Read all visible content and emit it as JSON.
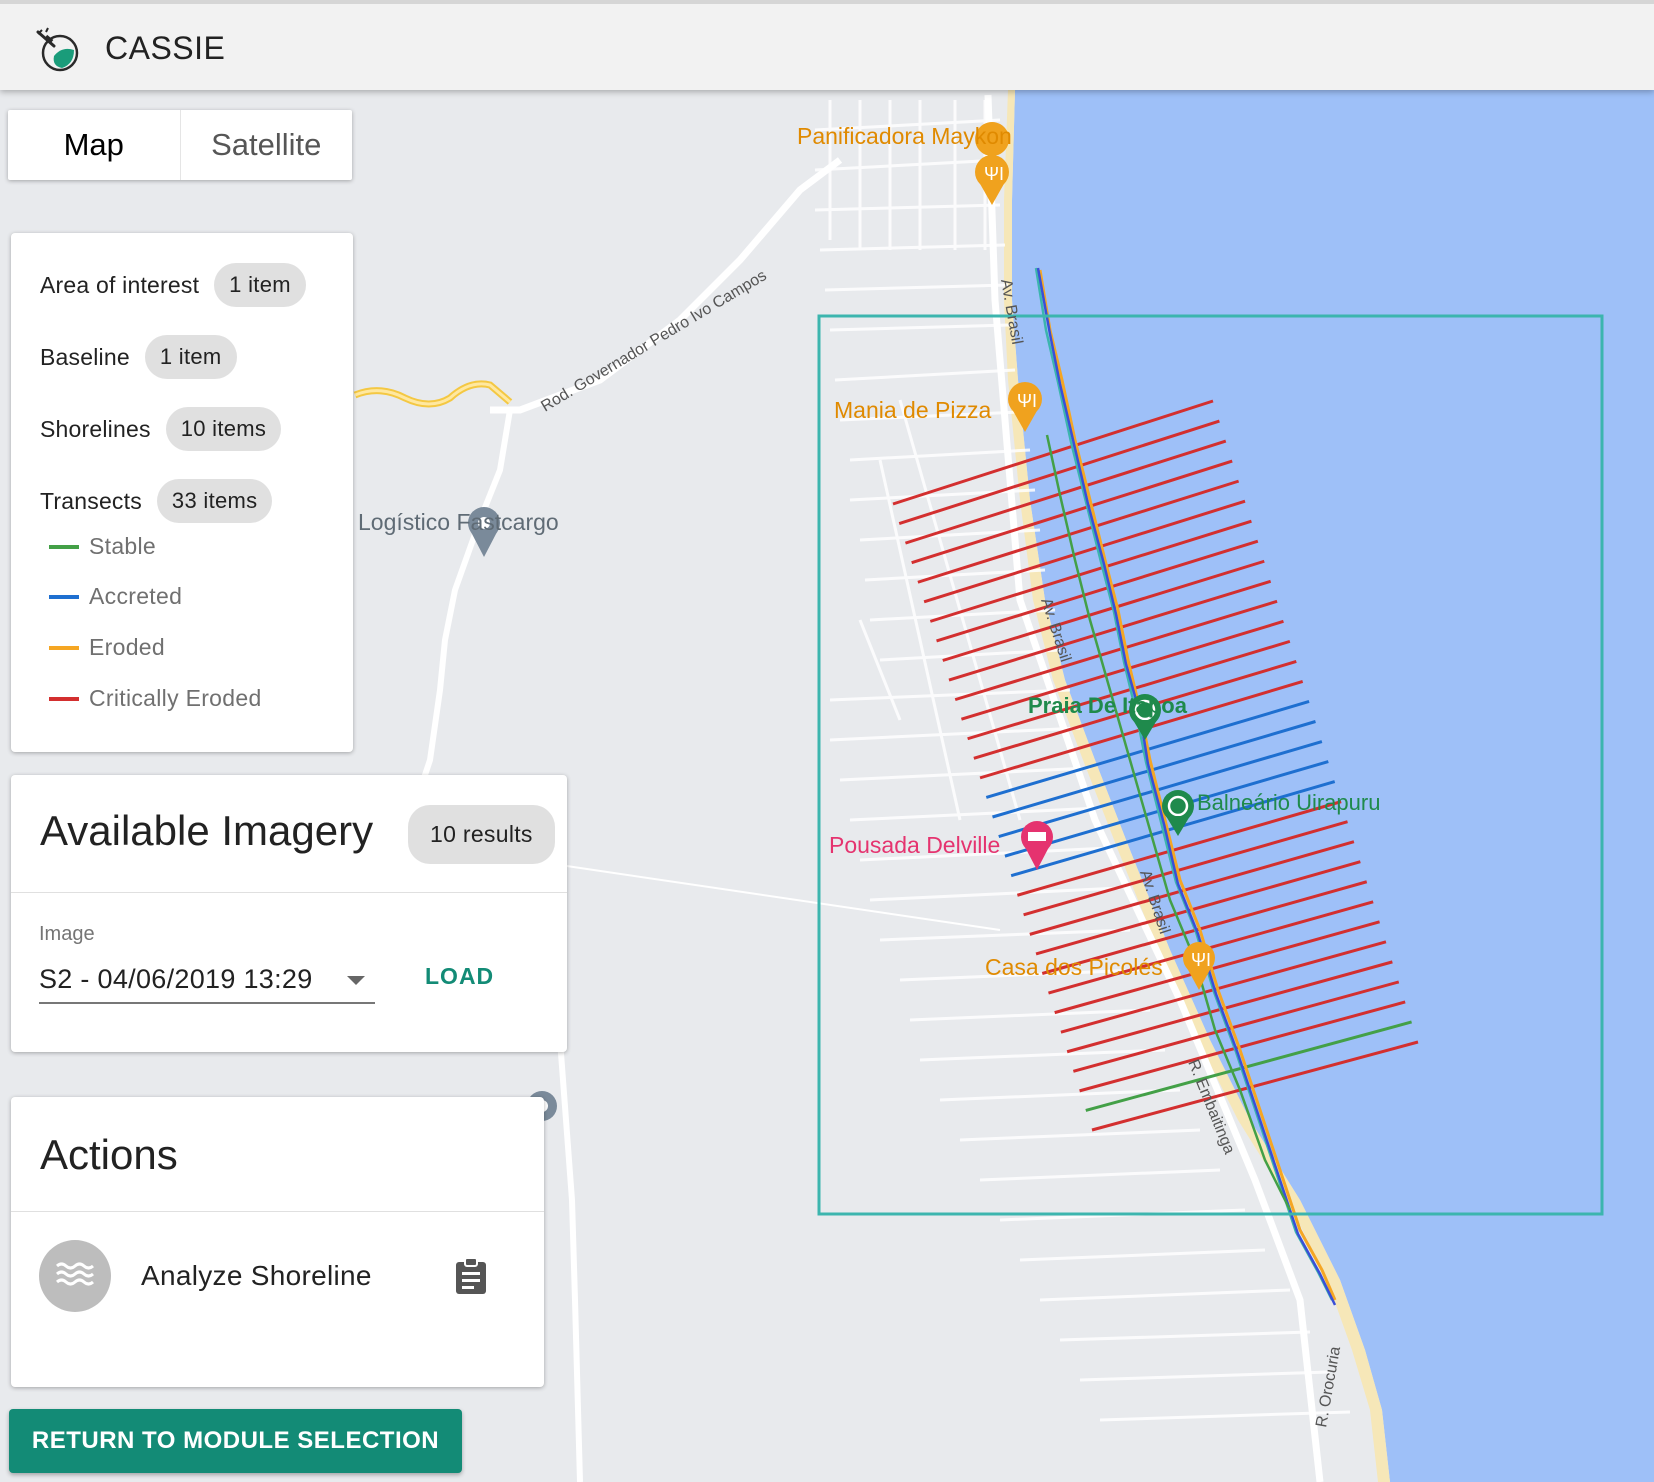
{
  "app": {
    "title": "CASSIE"
  },
  "map_type": {
    "map": "Map",
    "satellite": "Satellite"
  },
  "layers": [
    {
      "name": "Area of interest",
      "count": "1 item"
    },
    {
      "name": "Baseline",
      "count": "1 item"
    },
    {
      "name": "Shorelines",
      "count": "10 items"
    },
    {
      "name": "Transects",
      "count": "33 items"
    }
  ],
  "legend": [
    {
      "label": "Stable",
      "color": "#43a047"
    },
    {
      "label": "Accreted",
      "color": "#1e6fd0"
    },
    {
      "label": "Eroded",
      "color": "#f5a623"
    },
    {
      "label": "Critically Eroded",
      "color": "#d32f2f"
    }
  ],
  "imagery": {
    "title": "Available Imagery",
    "results": "10 results",
    "image_label": "Image",
    "selected_image": "S2 - 04/06/2019 13:29",
    "load_label": "LOAD"
  },
  "actions": {
    "title": "Actions",
    "items": [
      {
        "label": "Analyze Shoreline",
        "icon": "waves-icon"
      }
    ]
  },
  "return_button": "RETURN TO MODULE SELECTION",
  "map_labels": {
    "poi": [
      {
        "name": "Panificadora Maykon",
        "type": "restaurant"
      },
      {
        "name": "Mania de Pizza",
        "type": "restaurant"
      },
      {
        "name": "Logístico Fastcargo",
        "type": "place"
      },
      {
        "name": "Praia De Itapoa",
        "type": "beach"
      },
      {
        "name": "Balneário Uirapuru",
        "type": "beach"
      },
      {
        "name": "Pousada Delville",
        "type": "hotel"
      },
      {
        "name": "Casa dos Picolés",
        "type": "restaurant"
      }
    ],
    "roads": [
      "Rod. Governador Pedro Ivo Campos",
      "Av. Brasil",
      "R. Embaitinga",
      "R. Orocuria"
    ]
  },
  "colors": {
    "water": "#9ec0f8",
    "land": "#e8eaed",
    "aoi": "#3cb5ae",
    "primary": "#138b76",
    "restaurant": "#e08a00",
    "beach": "#1f8a4c",
    "hotel": "#e5336f"
  },
  "transect_sequence": [
    "critical",
    "critical",
    "critical",
    "critical",
    "critical",
    "critical",
    "critical",
    "critical",
    "critical",
    "critical",
    "critical",
    "critical",
    "critical",
    "critical",
    "critical",
    "accreted",
    "accreted",
    "accreted",
    "accreted",
    "accreted",
    "critical",
    "critical",
    "critical",
    "critical",
    "critical",
    "critical",
    "critical",
    "critical",
    "critical",
    "critical",
    "critical",
    "stable",
    "critical"
  ]
}
